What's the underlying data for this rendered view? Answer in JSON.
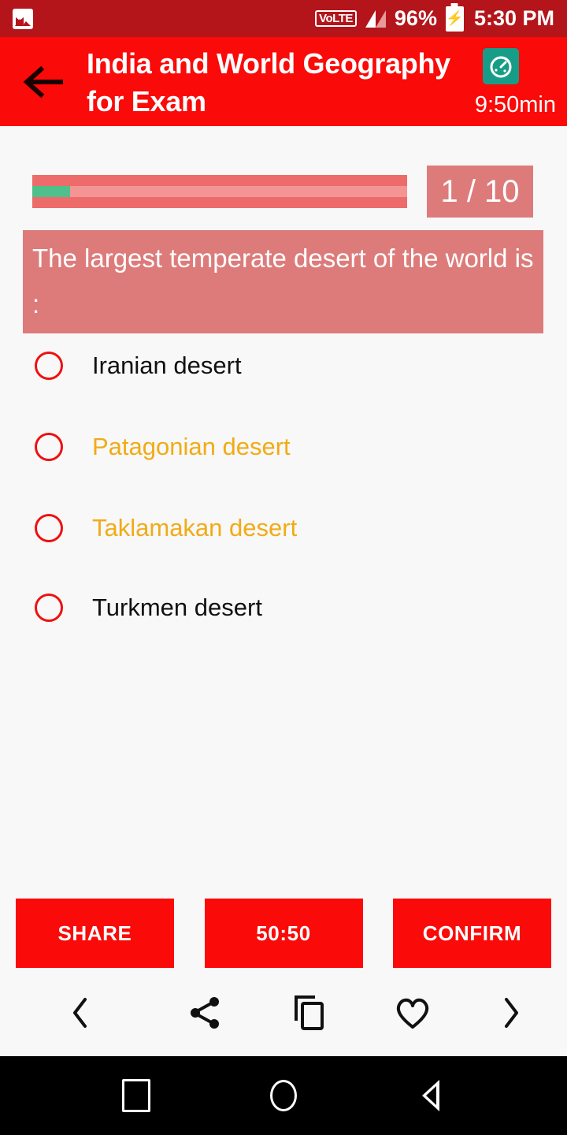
{
  "status_bar": {
    "photo_icon": "photo-icon",
    "volte_label": "VoLTE",
    "signal_icon": "signal-bars-icon",
    "battery_percent": "96%",
    "battery_icon": "battery-charging-icon",
    "time": "5:30 PM",
    "background_color": "#B3151A"
  },
  "header": {
    "back_icon": "back-arrow-icon",
    "title": "India and World Geography for Exam",
    "timer_icon": "timer-icon",
    "timer_text": "9:50min",
    "background_color": "#FA0A08",
    "timer_icon_color": "#179D87"
  },
  "progress": {
    "percent": 10,
    "counter": "1 / 10",
    "fill_color": "#4DC08C",
    "bar_color": "#EE6B6B",
    "counter_bg": "#DD7B7B"
  },
  "question": {
    "text": "The largest temperate desert of the world is :",
    "background_color": "#DD7B7B"
  },
  "options": [
    {
      "label": "Iranian desert",
      "highlighted": false,
      "selected": false
    },
    {
      "label": "Patagonian desert",
      "highlighted": true,
      "selected": false
    },
    {
      "label": "Taklamakan desert",
      "highlighted": true,
      "selected": false
    },
    {
      "label": "Turkmen desert",
      "highlighted": false,
      "selected": false
    }
  ],
  "option_colors": {
    "normal": "#111111",
    "highlight": "#F1AB15",
    "radio_ring": "#EE1111"
  },
  "actions": {
    "share_label": "SHARE",
    "fifty_label": "50:50",
    "confirm_label": "CONFIRM",
    "button_color": "#FA0A08"
  },
  "toolbar": {
    "prev_icon": "chevron-left-icon",
    "share_icon": "share-icon",
    "copy_icon": "copy-icon",
    "favorite_icon": "heart-outline-icon",
    "next_icon": "chevron-right-icon"
  },
  "navbar": {
    "recents_icon": "square-recents-icon",
    "home_icon": "circle-home-icon",
    "back_icon": "triangle-back-icon"
  }
}
